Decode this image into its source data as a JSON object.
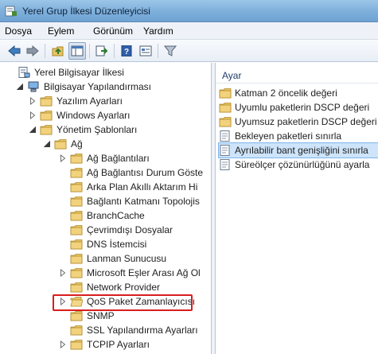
{
  "window": {
    "title": "Yerel Grup İlkesi Düzenleyicisi",
    "title_icon": "policy-editor-icon"
  },
  "menu": {
    "items": [
      "Dosya",
      "Eylem",
      "Görünüm",
      "Yardım"
    ]
  },
  "toolbar": {
    "buttons": [
      "back-arrow-icon",
      "forward-arrow-icon",
      "up-folder-icon",
      "show-hide-tree-icon",
      "export-list-icon",
      "help-icon",
      "properties-icon",
      "filter-icon"
    ],
    "active_button": "show-hide-tree-icon"
  },
  "tree": {
    "items": [
      {
        "label": "Yerel Bilgisayar İlkesi",
        "icon": "computer-policy-icon",
        "expander": "none"
      },
      {
        "label": "Bilgisayar Yapılandırması",
        "icon": "computer-icon",
        "expander": "expanded"
      },
      {
        "label": "Yazılım Ayarları",
        "icon": "folder-icon",
        "expander": "collapsed"
      },
      {
        "label": "Windows Ayarları",
        "icon": "folder-icon",
        "expander": "collapsed"
      },
      {
        "label": "Yönetim Şablonları",
        "icon": "folder-icon",
        "expander": "expanded"
      },
      {
        "label": "Ağ",
        "icon": "folder-icon",
        "expander": "expanded"
      },
      {
        "label": "Ağ Bağlantıları",
        "icon": "folder-icon",
        "expander": "collapsed"
      },
      {
        "label": "Ağ Bağlantısı Durum Göste",
        "icon": "folder-icon",
        "expander": "none"
      },
      {
        "label": "Arka Plan Akıllı Aktarım Hi",
        "icon": "folder-icon",
        "expander": "none"
      },
      {
        "label": "Bağlantı Katmanı Topolojis",
        "icon": "folder-icon",
        "expander": "none"
      },
      {
        "label": "BranchCache",
        "icon": "folder-icon",
        "expander": "none"
      },
      {
        "label": "Çevrimdışı Dosyalar",
        "icon": "folder-icon",
        "expander": "none"
      },
      {
        "label": "DNS İstemcisi",
        "icon": "folder-icon",
        "expander": "none"
      },
      {
        "label": "Lanman Sunucusu",
        "icon": "folder-icon",
        "expander": "none"
      },
      {
        "label": "Microsoft Eşler Arası Ağ Ol",
        "icon": "folder-icon",
        "expander": "collapsed"
      },
      {
        "label": "Network Provider",
        "icon": "folder-icon",
        "expander": "none"
      },
      {
        "label": "QoS Paket Zamanlayıcısı",
        "icon": "folder-open-icon",
        "expander": "collapsed",
        "highlighted": true
      },
      {
        "label": "SNMP",
        "icon": "folder-icon",
        "expander": "none"
      },
      {
        "label": "SSL Yapılandırma Ayarları",
        "icon": "folder-icon",
        "expander": "none"
      },
      {
        "label": "TCPIP Ayarları",
        "icon": "folder-icon",
        "expander": "collapsed"
      }
    ]
  },
  "list": {
    "column_header": "Ayar",
    "items": [
      {
        "label": "Katman 2 öncelik değeri",
        "icon": "folder-icon",
        "selected": false
      },
      {
        "label": "Uyumlu paketlerin DSCP değeri",
        "icon": "folder-icon",
        "selected": false
      },
      {
        "label": "Uyumsuz paketlerin DSCP değeri",
        "icon": "folder-icon",
        "selected": false
      },
      {
        "label": "Bekleyen paketleri sınırla",
        "icon": "policy-setting-icon",
        "selected": false
      },
      {
        "label": "Ayrılabilir bant genişliğini sınırla",
        "icon": "policy-setting-icon",
        "selected": true
      },
      {
        "label": "Süreölçer çözünürlüğünü ayarla",
        "icon": "policy-setting-icon",
        "selected": false
      }
    ]
  },
  "colors": {
    "highlight_border": "#d81e1e",
    "selection_bg": "#cde4fa",
    "folder": "#e8c462"
  }
}
